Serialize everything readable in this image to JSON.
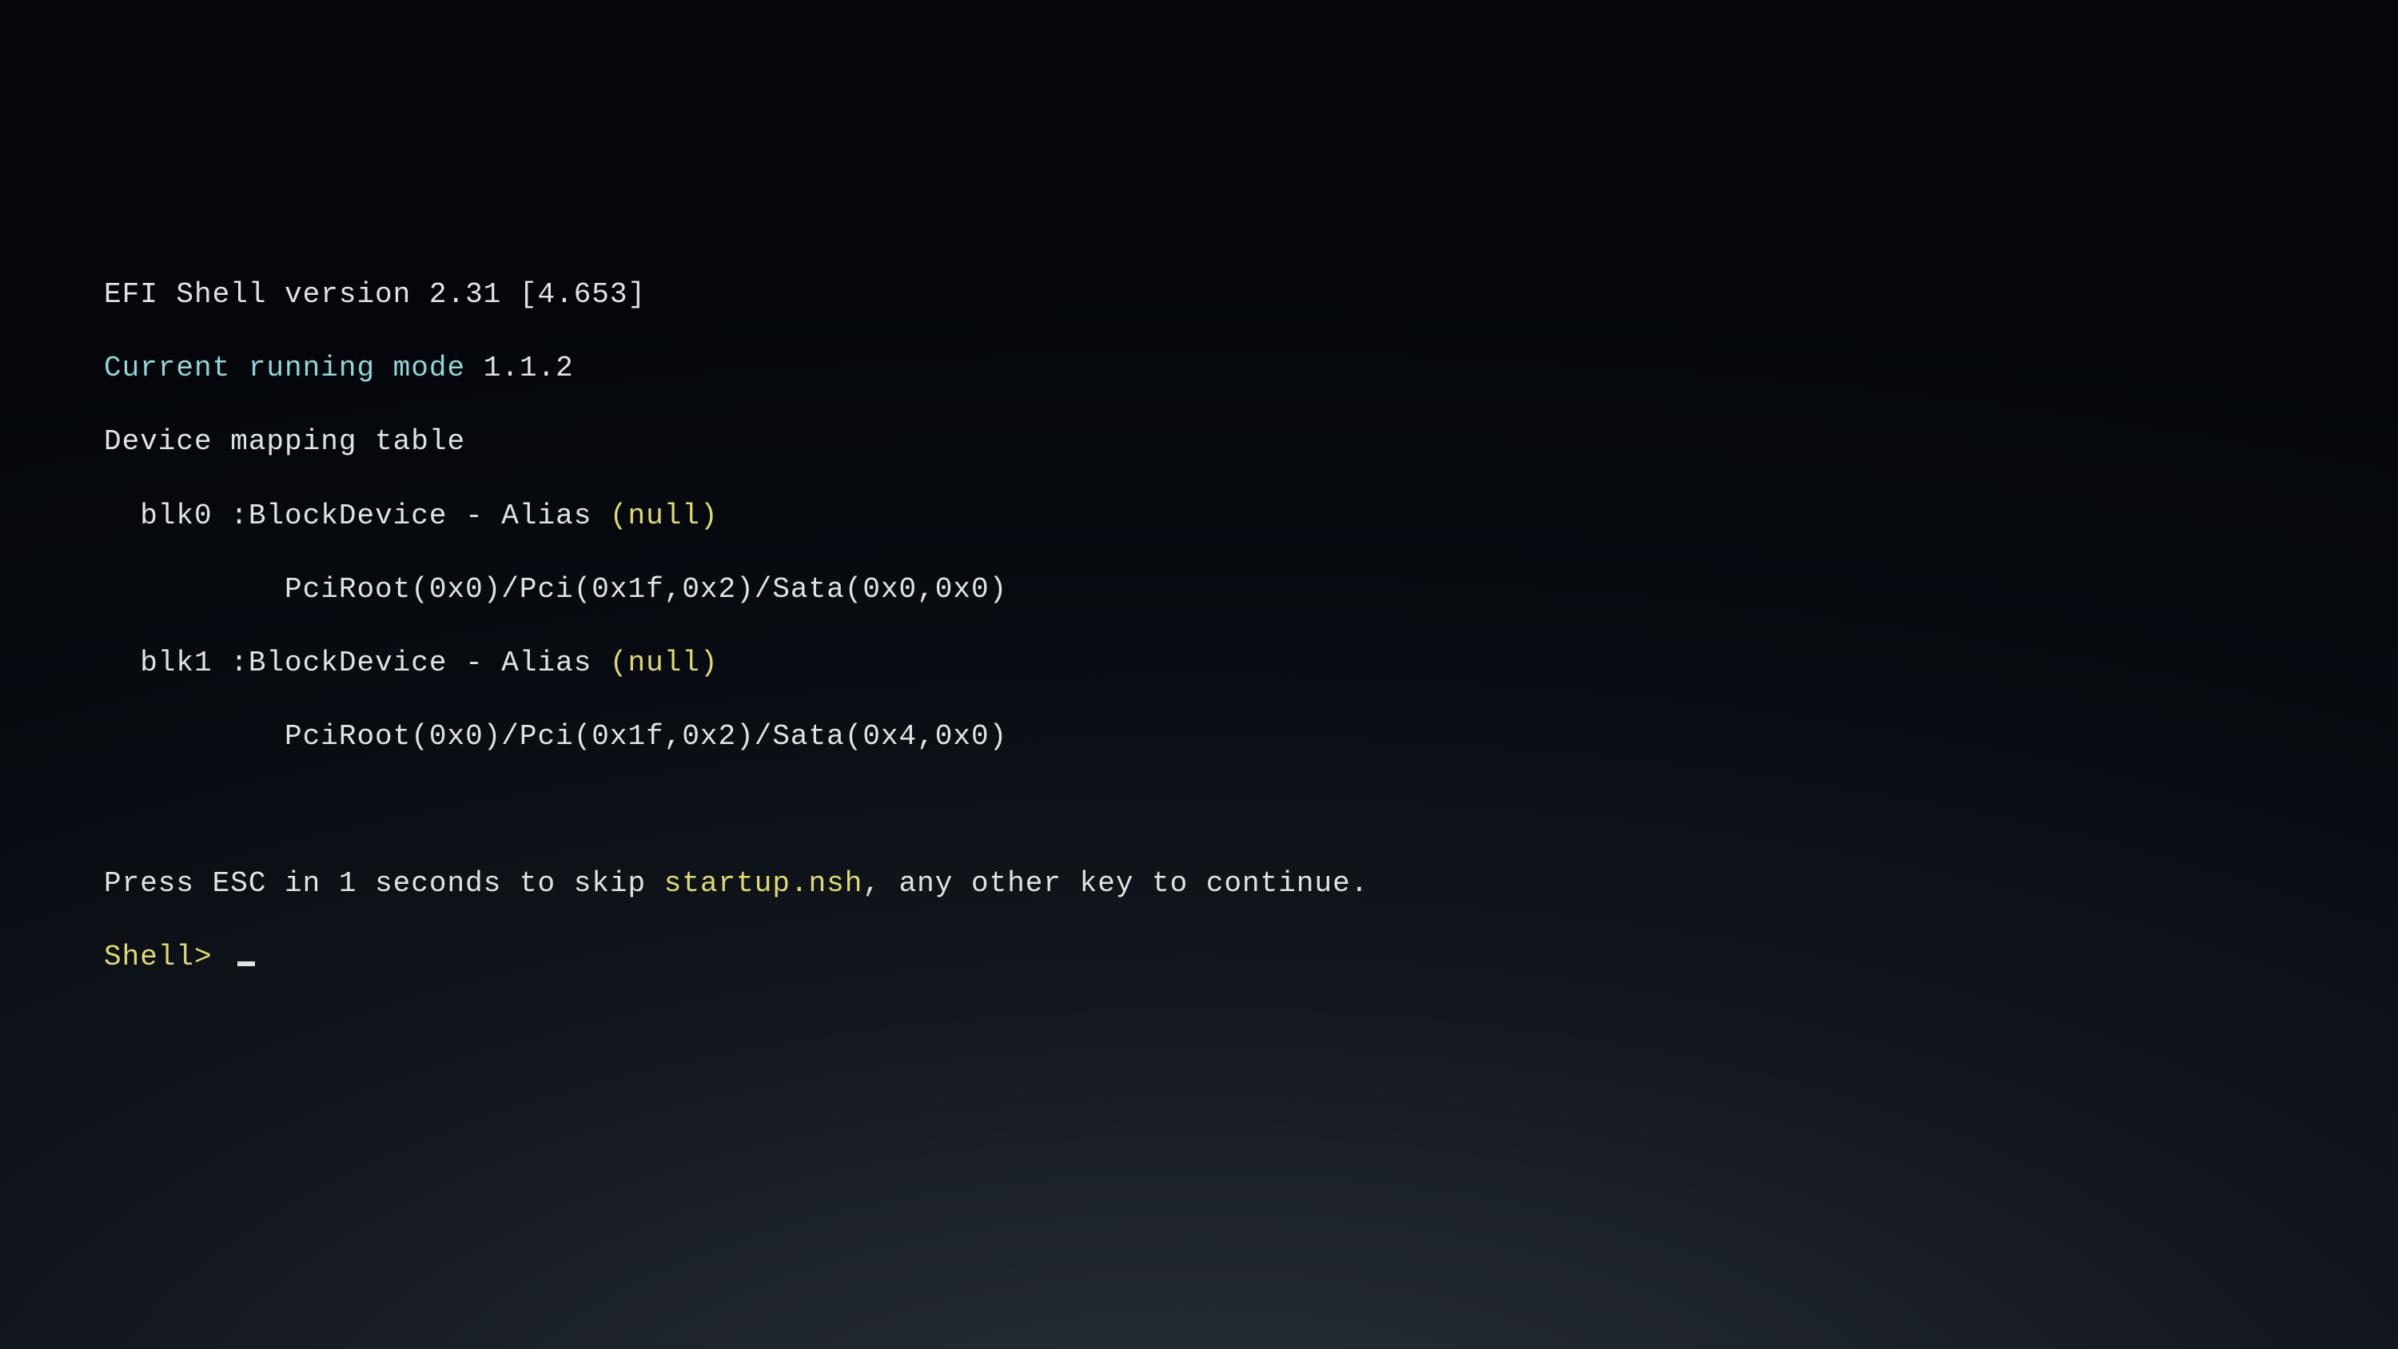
{
  "header": {
    "title_prefix": "EFI Shell version ",
    "version": "2.31 [4.653]",
    "mode_label": "Current running mode ",
    "mode_value": "1.1.2",
    "table_label": "Device mapping table"
  },
  "devices": [
    {
      "name": "  blk0 ",
      "type_prefix": ":BlockDevice - ",
      "alias_label": "Alias ",
      "alias_value": "(null)",
      "path": "          PciRoot(0x0)/Pci(0x1f,0x2)/Sata(0x0,0x0)"
    },
    {
      "name": "  blk1 ",
      "type_prefix": ":BlockDevice - ",
      "alias_label": "Alias ",
      "alias_value": "(null)",
      "path": "          PciRoot(0x0)/Pci(0x1f,0x2)/Sata(0x4,0x0)"
    }
  ],
  "countdown": {
    "prefix": "Press ESC in ",
    "seconds": "1",
    "mid": " seconds to skip ",
    "script": "startup.nsh",
    "suffix": ", any other key to continue."
  },
  "prompt": {
    "label": "Shell> "
  }
}
